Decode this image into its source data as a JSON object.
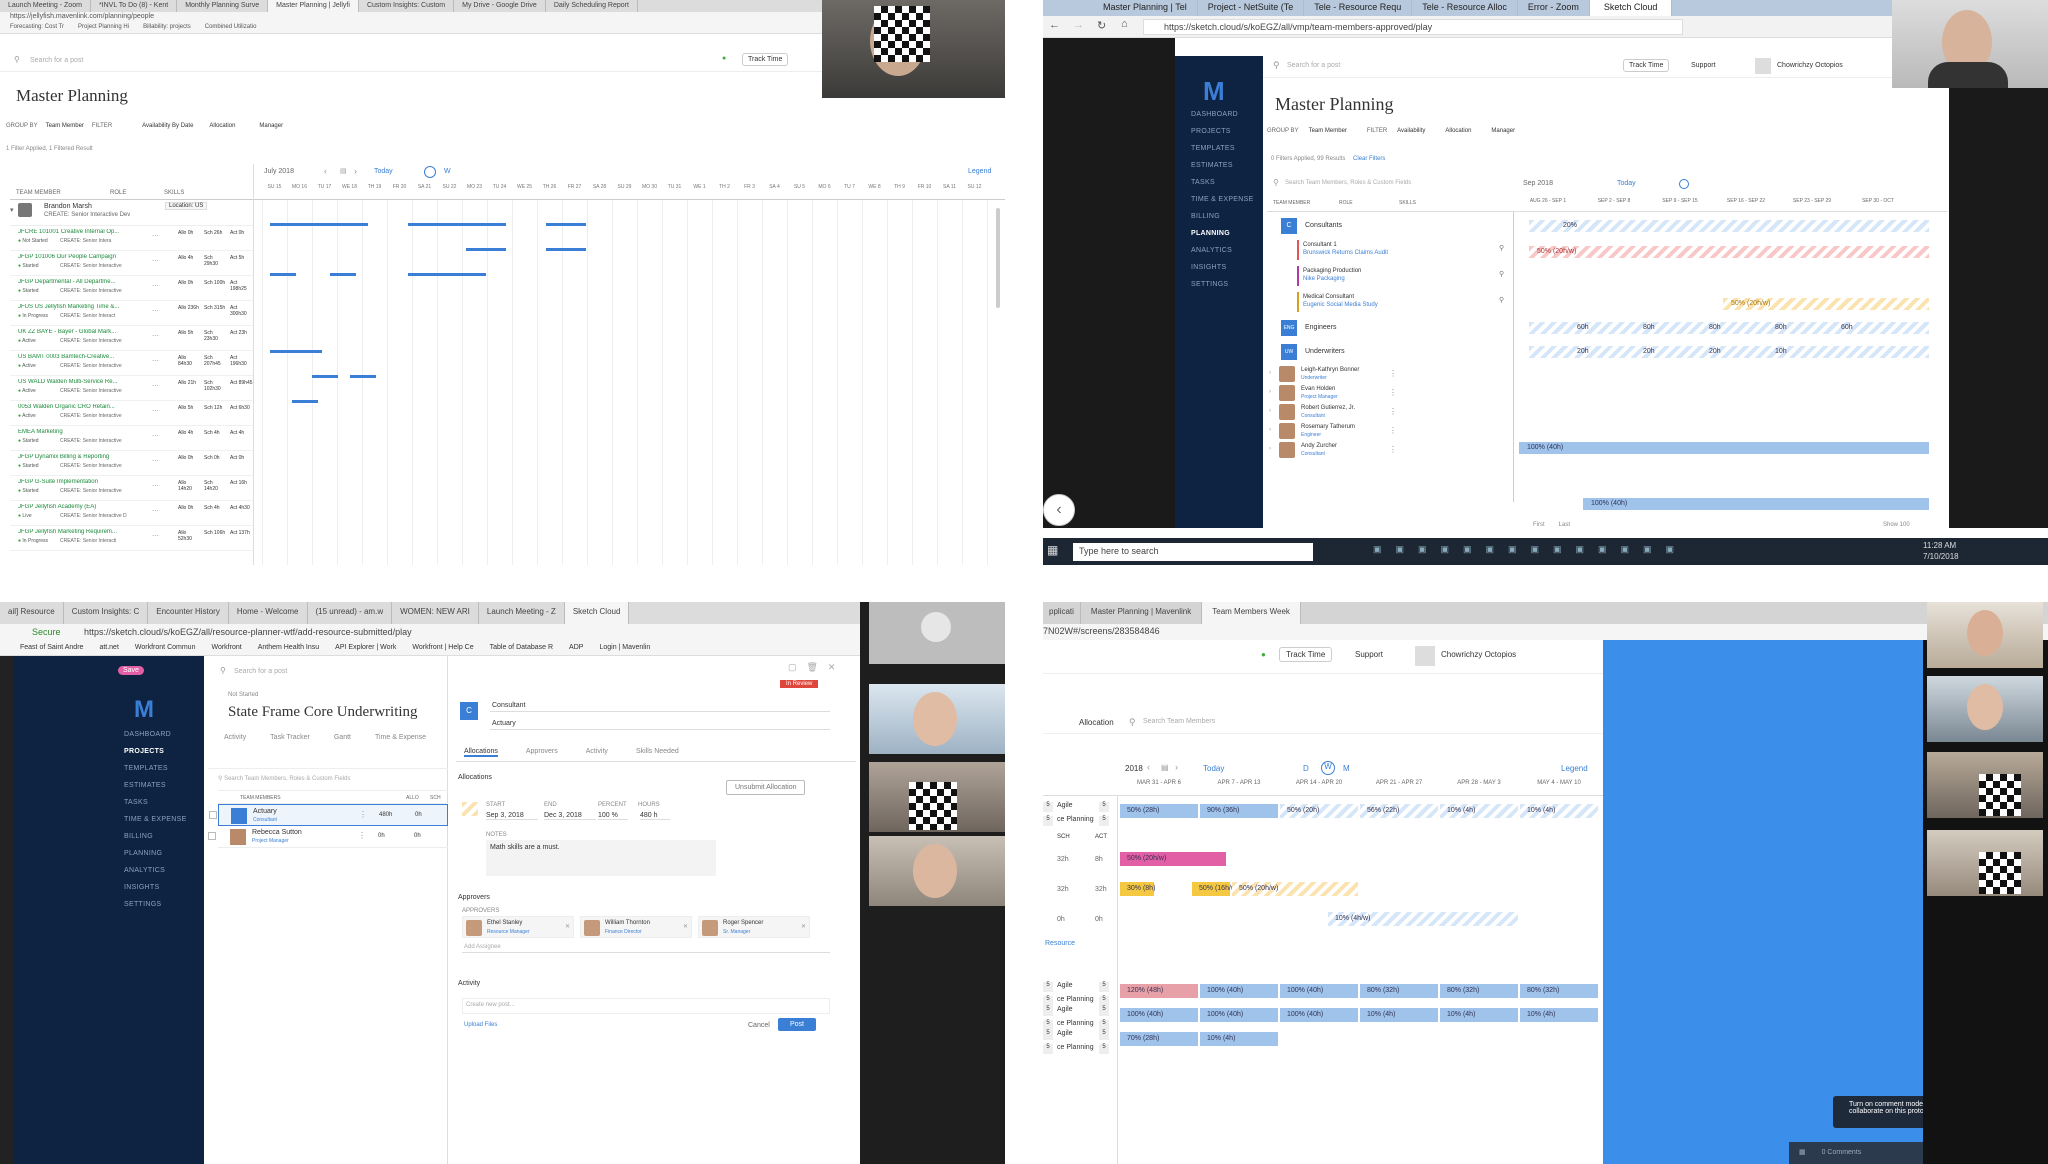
{
  "q1": {
    "tabs": [
      "Launch Meeting - Zoom",
      "*INVL To Do (8) - Kent",
      "Monthly Planning Surve",
      "Master Planning | Jellyfi",
      "Custom Insights: Custom",
      "My Drive - Google Drive",
      "Daily Scheduling Report"
    ],
    "url": "https://jellyfish.mavenlink.com/planning/people",
    "bookmarks": [
      "Forecasting: Cost Tr",
      "Project Planning Hi",
      "Billability: projects",
      "Combined Utilizatio"
    ],
    "search_placeholder": "Search for a post",
    "track_time": "Track Time",
    "page_title": "Master Planning",
    "group_by_label": "GROUP BY",
    "group_by_value": "Team Member",
    "filter_label": "FILTER",
    "filter_value": "Availability By Date",
    "allocation": "Allocation",
    "manager": "Manager",
    "filter_status": "1 Filter Applied, 1 Filtered Result",
    "col_team_member": "TEAM MEMBER",
    "col_role": "ROLE",
    "col_skills": "SKILLS",
    "month": "July 2018",
    "today": "Today",
    "view_w": "W",
    "legend": "Legend",
    "person_name": "Brandon Marsh",
    "person_role": "CREATE: Senior Interactive Dev",
    "location": "Location: US",
    "days": [
      "SU 15",
      "MO 16",
      "TU 17",
      "WE 18",
      "TH 19",
      "FR 20",
      "SA 21",
      "SU 22",
      "MO 23",
      "TU 24",
      "WE 25",
      "TH 26",
      "FR 27",
      "SA 28",
      "SU 29",
      "MO 30",
      "TU 31",
      "WE 1",
      "TH 2",
      "FR 3",
      "SA 4",
      "SU 5",
      "MO 6",
      "TU 7",
      "WE 8",
      "TH 9",
      "FR 10",
      "SA 11",
      "SU 12"
    ],
    "projects": [
      {
        "name": "JFCRE 101001 Creative Internal Op...",
        "status": "Not Started",
        "role": "CREATE: Senior Intera",
        "a": "Allo 0h",
        "s": "Sch 26h",
        "c": "Act 0h"
      },
      {
        "name": "JFGP 101006 Our People Campaign",
        "status": "Started",
        "role": "CREATE: Senior Interactive",
        "a": "Allo 4h",
        "s": "Sch 29h30",
        "c": "Act 5h"
      },
      {
        "name": "JFGP Departmental - All Departme...",
        "status": "Started",
        "role": "CREATE: Senior Interactive",
        "a": "Allo 0h",
        "s": "Sch 100h",
        "c": "Act 198h25"
      },
      {
        "name": "JFUS US Jellyfish Marketing Time &...",
        "status": "In Progress",
        "role": "CREATE: Senior Interact",
        "a": "Allo 236h",
        "s": "Sch 315h",
        "c": "Act 300h30"
      },
      {
        "name": "UK ZZ BAYE - Bayer - Global Mark...",
        "status": "Active",
        "role": "CREATE: Senior Interactive",
        "a": "Allo 5h",
        "s": "Sch 23h30",
        "c": "Act 23h"
      },
      {
        "name": "US BAMT 0003 Bamtech-Creative...",
        "status": "Active",
        "role": "CREATE: Senior Interactive",
        "a": "Allo 84h30",
        "s": "Sch 207h45",
        "c": "Act 196h30"
      },
      {
        "name": "US WALD Walden Multi-Service Re...",
        "status": "Active",
        "role": "CREATE: Senior Interactive",
        "a": "Allo 21h",
        "s": "Sch 102h30",
        "c": "Act 89h45"
      },
      {
        "name": "0053 Walden Organic CRO Retain...",
        "status": "Active",
        "role": "CREATE: Senior Interactive",
        "a": "Allo 5h",
        "s": "Sch 12h",
        "c": "Act 6h30"
      },
      {
        "name": "EMEA Marketing",
        "status": "Started",
        "role": "CREATE: Senior Interactive",
        "a": "Allo 4h",
        "s": "Sch 4h",
        "c": "Act 4h"
      },
      {
        "name": "JFGP Dynamix Billing & Reporting",
        "status": "Started",
        "role": "CREATE: Senior Interactive",
        "a": "Allo 0h",
        "s": "Sch 0h",
        "c": "Act 0h"
      },
      {
        "name": "JFGP G-Suite Implementation",
        "status": "Started",
        "role": "CREATE: Senior Interactive",
        "a": "Allo 14h20",
        "s": "Sch 14h20",
        "c": "Act 16h"
      },
      {
        "name": "JFGP Jellyfish Academy (EA)",
        "status": "Live",
        "role": "CREATE: Senior Interactive D",
        "a": "Allo 0h",
        "s": "Sch 4h",
        "c": "Act 4h30"
      },
      {
        "name": "JFGP Jellyfish Marketing Requirem...",
        "status": "In Progress",
        "role": "CREATE: Senior Interacti",
        "a": "Allo 52h30",
        "s": "Sch 106h",
        "c": "Act 137h"
      }
    ]
  },
  "q2": {
    "tabs": [
      "Master Planning | Tel",
      "Project - NetSuite (Te",
      "Tele - Resource Requ",
      "Tele - Resource Alloc",
      "Error - Zoom",
      "Sketch Cloud"
    ],
    "url": "https://sketch.cloud/s/koEGZ/all/vmp/team-members-approved/play",
    "search_placeholder": "Search for a post",
    "track_time": "Track Time",
    "support": "Support",
    "account": "Chowrichzy Octopios",
    "page_title": "Master Planning",
    "nav": [
      "DASHBOARD",
      "PROJECTS",
      "TEMPLATES",
      "ESTIMATES",
      "TASKS",
      "TIME & EXPENSE",
      "BILLING",
      "PLANNING",
      "ANALYTICS",
      "INSIGHTS",
      "SETTINGS"
    ],
    "group_by": "Team Member",
    "filter": "Availability",
    "allocation": "Allocation",
    "manager": "Manager",
    "filter_status": "0 Filters Applied, 99 Results",
    "clear_filters": "Clear Filters",
    "member_search": "Search Team Members, Roles & Custom Fields",
    "month": "Sep 2018",
    "today": "Today",
    "col_team_member": "TEAM MEMBER",
    "col_role": "ROLE",
    "col_skills": "SKILLS",
    "weeks": [
      "AUG 26 - SEP 1",
      "SEP 2 - SEP 8",
      "SEP 9 - SEP 15",
      "SEP 16 - SEP 22",
      "SEP 23 - SEP 29",
      "SEP 30 - OCT"
    ],
    "groups": [
      {
        "code": "C",
        "name": "Consultants"
      },
      {
        "code": "ENG",
        "name": "Engineers"
      },
      {
        "code": "UW",
        "name": "Underwriters"
      }
    ],
    "consultants": [
      {
        "name": "Consultant 1",
        "project": "Brunswick Returns Claims Audit"
      },
      {
        "name": "Packaging Production",
        "project": "Nike Packaging"
      },
      {
        "name": "Medical Consultant",
        "project": "Eugenic Social Media Study"
      }
    ],
    "people": [
      {
        "name": "Leigh-Kathryn Bonner",
        "role": "Underwriter"
      },
      {
        "name": "Evan Holden",
        "role": "Project Manager"
      },
      {
        "name": "Robert Gutierrez, Jr.",
        "role": "Consultant"
      },
      {
        "name": "Rosemary Tatherum",
        "role": "Engineer"
      },
      {
        "name": "Andy Zurcher",
        "role": "Consultant"
      }
    ],
    "bars": {
      "consultants_pct": "20%",
      "cons1": "50% (20h/w)",
      "med": "50% (20h/w)",
      "eng": [
        "60h",
        "80h",
        "80h",
        "80h",
        "60h"
      ],
      "uw": [
        "20h",
        "20h",
        "20h",
        "10h"
      ],
      "leigh": "100% (40h)",
      "robert": "100% (40h)"
    },
    "pager_first": "First",
    "pager_last": "Last",
    "show": "Show 100",
    "taskbar_search": "Type here to search",
    "clock_time": "11:28 AM",
    "clock_date": "7/10/2018"
  },
  "q3": {
    "tabs": [
      "ail] Resource",
      "Custom Insights: C",
      "Encounter History",
      "Home - Welcome",
      "(15 unread) - am.w",
      "WOMEN: NEW ARI",
      "Launch Meeting - Z",
      "Sketch Cloud"
    ],
    "secure": "Secure",
    "url": "https://sketch.cloud/s/koEGZ/all/resource-planner-wtf/add-resource-submitted/play",
    "bookmarks": [
      "Feast of Saint Andre",
      "att.net",
      "Workfront Commun",
      "Workfront",
      "Anthem Health Insu",
      "API Explorer | Work",
      "Workfront | Help Ce",
      "Table of Database R",
      "ADP",
      "Login | Mavenlin"
    ],
    "save": "Save",
    "nav": [
      "DASHBOARD",
      "PROJECTS",
      "TEMPLATES",
      "ESTIMATES",
      "TASKS",
      "TIME & EXPENSE",
      "BILLING",
      "PLANNING",
      "ANALYTICS",
      "INSIGHTS",
      "SETTINGS"
    ],
    "search_placeholder": "Search for a post",
    "status": "Not Started",
    "project_title": "State Frame Core Underwriting",
    "project_tabs": [
      "Activity",
      "Task Tracker",
      "Gantt",
      "Time & Expense"
    ],
    "member_search": "Search Team Members, Roles & Custom Fields",
    "col_team_members": "TEAM MEMBERS",
    "col_allo": "ALLO",
    "col_sch": "SCH",
    "members": [
      {
        "name": "Actuary",
        "role": "Consultant",
        "allo": "480h",
        "sch": "0h"
      },
      {
        "name": "Rebecca Sutton",
        "role": "Project Manager",
        "allo": "0h",
        "sch": "0h"
      }
    ],
    "review_badge": "In Review",
    "role_select": "Consultant",
    "role_name": "Actuary",
    "panel_tabs": [
      "Allocations",
      "Approvers",
      "Activity",
      "Skills Needed"
    ],
    "allocations_header": "Allocations",
    "unsubmit": "Unsubmit Allocation",
    "start_label": "START",
    "end_label": "END",
    "percent_label": "PERCENT",
    "hours_label": "HOURS",
    "start": "Sep 3, 2018",
    "end": "Dec 3, 2018",
    "percent": "100 %",
    "hours": "480 h",
    "notes_label": "NOTES",
    "notes": "Math skills are a must.",
    "approvers_header": "Approvers",
    "approvers_label": "APPROVERS",
    "approvers": [
      {
        "name": "Ethel Stanley",
        "title": "Resource Manager"
      },
      {
        "name": "William Thornton",
        "title": "Finance Director"
      },
      {
        "name": "Roger Spencer",
        "title": "Sr. Manager"
      }
    ],
    "add_approver": "Add Assignee",
    "activity_header": "Activity",
    "post_placeholder": "Create new post...",
    "upload": "Upload Files",
    "cancel": "Cancel",
    "post": "Post"
  },
  "q4": {
    "tabs": [
      "pplicati",
      "Master Planning | Mavenlink",
      "Team Members Week"
    ],
    "url": "7N02W#/screens/283584846",
    "track_time": "Track Time",
    "support": "Support",
    "account": "Chowrichzy Octopios",
    "allocation": "Allocation",
    "member_search": "Search Team Members",
    "year": "2018",
    "today": "Today",
    "view_d": "D",
    "view_w": "W",
    "view_m": "M",
    "legend": "Legend",
    "weeks": [
      "MAR 31 - APR 6",
      "APR 7 - APR 13",
      "APR 14 - APR 20",
      "APR 21 - APR 27",
      "APR 28 - MAY 3",
      "MAY 4 - MAY 10"
    ],
    "row_agile": "Agile",
    "row_planning": "ce Planning",
    "badge": "5",
    "sch": "SCH",
    "act": "ACT",
    "hours_rows": [
      [
        "32h",
        "8h"
      ],
      [
        "32h",
        "32h"
      ],
      [
        "0h",
        "0h"
      ]
    ],
    "resource_link": "Resource",
    "top_bars": [
      "50% (28h)",
      "90% (36h)",
      "50% (20h)",
      "56% (22h)",
      "10% (4h)",
      "10% (4h)"
    ],
    "pink_bar": "50% (20h/w)",
    "yellow_bars": [
      "30% (8h)",
      "50% (16h/w)",
      "50% (20h/w)"
    ],
    "light_bar": "10% (4h/w)",
    "lower_a": [
      "120% (48h)",
      "100% (40h)",
      "100% (40h)",
      "80% (32h)",
      "80% (32h)",
      "80% (32h)"
    ],
    "lower_b": [
      "100% (40h)",
      "100% (40h)",
      "100% (40h)",
      "10% (4h)",
      "10% (4h)",
      "10% (4h)"
    ],
    "lower_c": [
      "70% (28h)",
      "10% (4h)"
    ],
    "comment_tip": "Turn on comment mode to collaborate on this prototype",
    "comments": "0 Comments"
  },
  "colors": {
    "nav_bg": "#0e2342",
    "accent": "#3a7fd5",
    "pink": "#e25fa5",
    "yellow": "#f5c842",
    "review": "#e0473c"
  }
}
